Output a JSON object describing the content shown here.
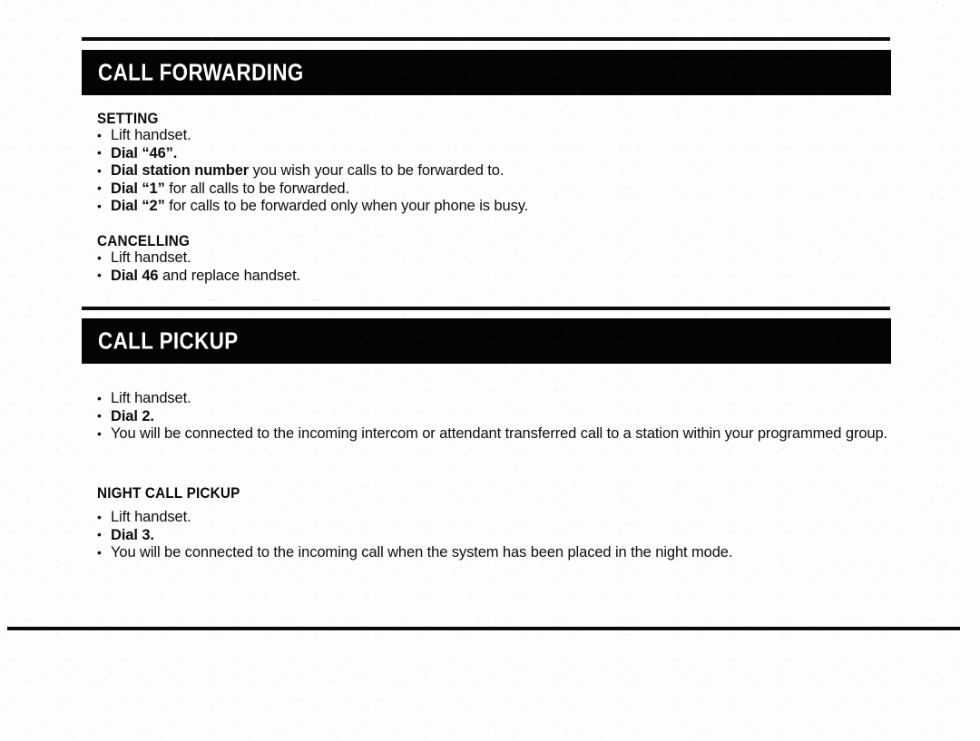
{
  "document": {
    "title": "Call Forwarding / Call Pickup instruction page",
    "page_background": "#fdfdfd",
    "ink_color": "#0a0a0a",
    "bar_text_color": "#ffffff"
  },
  "sections": [
    {
      "id": "call-forwarding",
      "bar_title": "CALL FORWARDING",
      "groups": [
        {
          "id": "setting",
          "heading": "SETTING",
          "items": [
            {
              "bold": "",
              "rest": "Lift handset."
            },
            {
              "bold": "Dial “46”.",
              "rest": ""
            },
            {
              "bold": "Dial station number",
              "rest": " you wish your calls to be forwarded to."
            },
            {
              "bold": "Dial “1”",
              "rest": " for all calls to be forwarded."
            },
            {
              "bold": "Dial “2”",
              "rest": " for calls to be forwarded only when your phone is busy."
            }
          ]
        },
        {
          "id": "cancelling",
          "heading": "CANCELLING",
          "items": [
            {
              "bold": "",
              "rest": "Lift handset."
            },
            {
              "bold": "Dial 46",
              "rest": " and replace handset."
            }
          ]
        }
      ]
    },
    {
      "id": "call-pickup",
      "bar_title": "CALL PICKUP",
      "groups": [
        {
          "id": "pickup",
          "heading": "",
          "items": [
            {
              "bold": "",
              "rest": "Lift handset."
            },
            {
              "bold": "Dial 2.",
              "rest": ""
            },
            {
              "bold": "",
              "rest": "You will be connected to the incoming intercom or attendant transferred call to a station within your programmed group."
            }
          ]
        },
        {
          "id": "night-call-pickup",
          "heading": "NIGHT CALL PICKUP",
          "items": [
            {
              "bold": "",
              "rest": "Lift handset."
            },
            {
              "bold": "Dial 3.",
              "rest": ""
            },
            {
              "bold": "",
              "rest": "You will be connected to the incoming call when the system has been placed in the night mode."
            }
          ]
        }
      ]
    }
  ]
}
